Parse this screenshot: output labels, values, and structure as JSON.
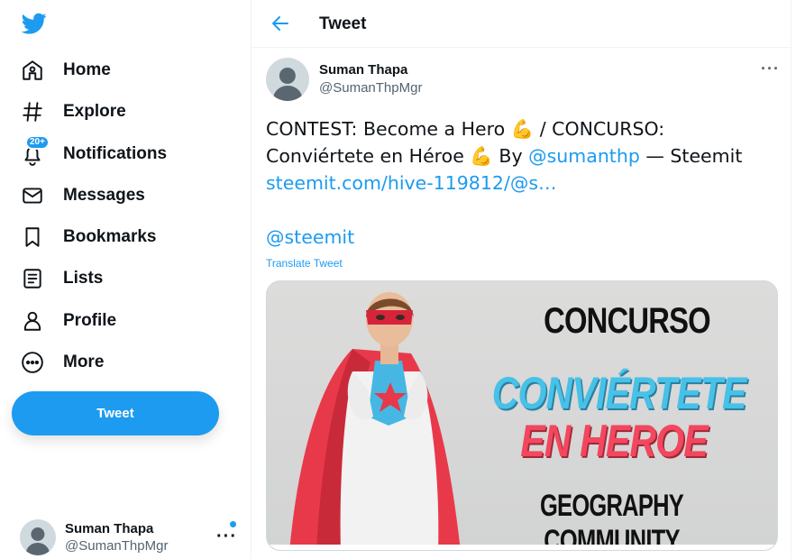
{
  "sidebar": {
    "logo": "twitter-bird-icon",
    "items": [
      {
        "label": "Home",
        "icon": "home-icon"
      },
      {
        "label": "Explore",
        "icon": "hashtag-icon"
      },
      {
        "label": "Notifications",
        "icon": "bell-icon",
        "badge": "20+"
      },
      {
        "label": "Messages",
        "icon": "envelope-icon"
      },
      {
        "label": "Bookmarks",
        "icon": "bookmark-icon"
      },
      {
        "label": "Lists",
        "icon": "list-icon"
      },
      {
        "label": "Profile",
        "icon": "person-icon"
      },
      {
        "label": "More",
        "icon": "more-circle-icon"
      }
    ],
    "tweet_button": "Tweet",
    "account": {
      "name": "Suman Thapa",
      "handle": "@SumanThpMgr",
      "more": "···"
    }
  },
  "header": {
    "title": "Tweet"
  },
  "tweet": {
    "author_name": "Suman Thapa",
    "author_handle": "@SumanThpMgr",
    "more": "···",
    "text_part1": "CONTEST: Become a Hero ",
    "emoji1": "💪",
    "text_part2": " / CONCURSO: Conviértete en Héroe ",
    "emoji2": "💪",
    "text_part3": " By ",
    "mention1": "@sumanthp",
    "text_part4": " — Steemit ",
    "link": "steemit.com/hive-119812/@s…",
    "mention2": "@steemit",
    "translate": "Translate Tweet",
    "media": {
      "line1": "CONCURSO",
      "line2": "CONVIÉRTETE",
      "line3": "EN HEROE",
      "line4": "GEOGRAPHY COMMUNITY"
    }
  },
  "colors": {
    "accent": "#1d9bf0",
    "text": "#0f1419",
    "secondary": "#536471"
  }
}
